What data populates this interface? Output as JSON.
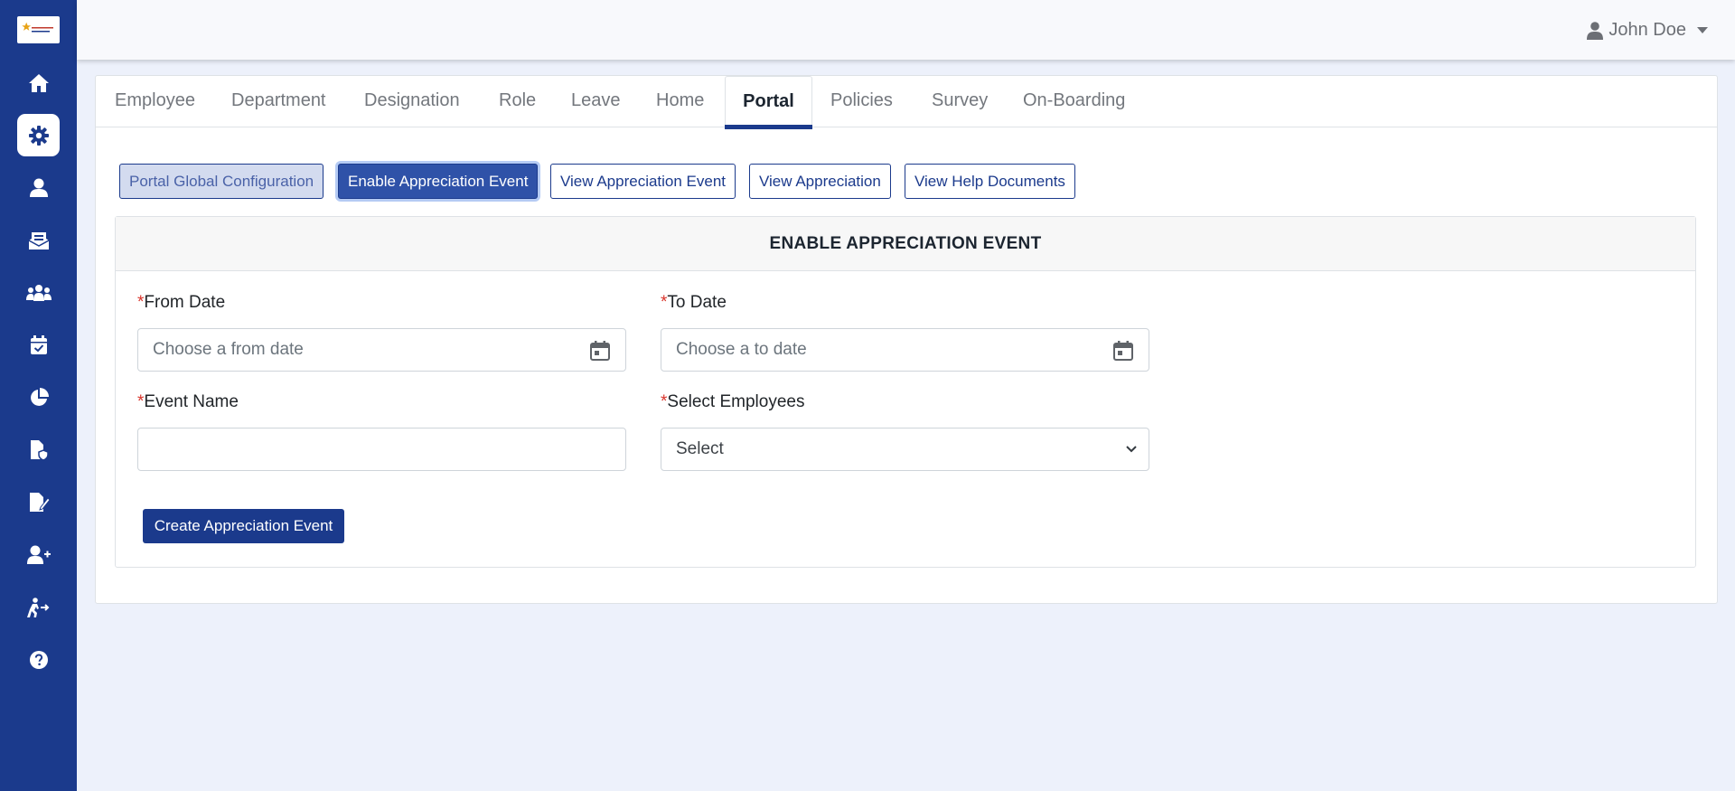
{
  "header": {
    "user_name": "John Doe"
  },
  "sidebar": {
    "items": [
      {
        "icon": "home-icon"
      },
      {
        "icon": "gear-icon",
        "active": true
      },
      {
        "icon": "user-icon"
      },
      {
        "icon": "inbox-icon"
      },
      {
        "icon": "users-group-icon"
      },
      {
        "icon": "calendar-check-icon"
      },
      {
        "icon": "pie-chart-icon"
      },
      {
        "icon": "file-shield-icon"
      },
      {
        "icon": "file-signature-icon"
      },
      {
        "icon": "user-plus-icon"
      },
      {
        "icon": "person-exit-icon"
      },
      {
        "icon": "help-icon"
      }
    ]
  },
  "tabs": [
    "Employee",
    "Department",
    "Designation",
    "Role",
    "Leave",
    "Home",
    "Portal",
    "Policies",
    "Survey",
    "On-Boarding"
  ],
  "active_tab": "Portal",
  "sub_buttons": [
    "Portal Global Configuration",
    "Enable Appreciation Event",
    "View Appreciation Event",
    "View Appreciation",
    "View Help Documents"
  ],
  "form": {
    "title": "ENABLE APPRECIATION EVENT",
    "required_mark": "*",
    "from_date": {
      "label": "From Date",
      "placeholder": "Choose a from date"
    },
    "to_date": {
      "label": "To Date",
      "placeholder": "Choose a to date"
    },
    "event_name": {
      "label": "Event Name",
      "value": ""
    },
    "select_employees": {
      "label": "Select Employees",
      "selected": "Select"
    },
    "submit_label": "Create Appreciation Event"
  },
  "colors": {
    "primary": "#1b3a8c",
    "page_background": "#edf1fb",
    "required": "#d9342b"
  }
}
